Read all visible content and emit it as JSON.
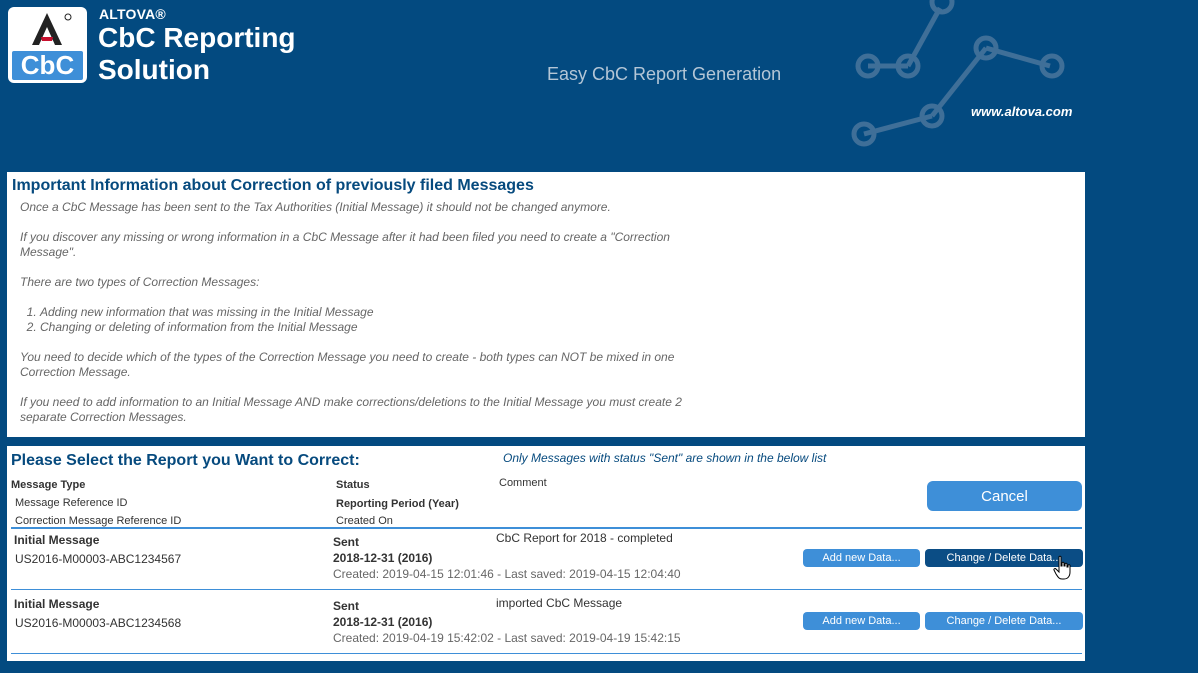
{
  "header": {
    "logo_top": "A",
    "logo_label": "CbC",
    "brand_small": "ALTOVA®",
    "brand_line1": "CbC Reporting",
    "brand_line2": "Solution",
    "tagline": "Easy CbC Report Generation",
    "website": "www.altova.com"
  },
  "info": {
    "title": "Important Information about Correction of previously filed Messages",
    "p1": "Once a CbC Message has been sent to the Tax Authorities (Initial Message) it should not be changed anymore.",
    "p2": "If you discover any missing or wrong information in a CbC Message after it had been filed you need to create a \"Correction Message\".",
    "p3": "There are two types of Correction Messages:",
    "items": [
      "Adding new information that was missing in the Initial Message",
      "Changing or deleting of information from the Initial Message"
    ],
    "p4": "You need to decide which of the types of the Correction Message you need to create - both types can NOT be mixed in one Correction Message.",
    "p5": "If you need to add information to an Initial Message AND make corrections/deletions to the Initial Message you must create 2 separate Correction Messages."
  },
  "select": {
    "title": "Please Select the Report you Want to Correct:",
    "note": "Only Messages with status \"Sent\" are shown in the below list",
    "headers": {
      "message_type": "Message Type",
      "message_ref": "Message Reference ID",
      "correction_ref": "Correction Message Reference ID",
      "status": "Status",
      "reporting_period": "Reporting Period (Year)",
      "created_on": "Created On",
      "comment": "Comment"
    },
    "cancel_label": "Cancel",
    "rows": [
      {
        "type": "Initial Message",
        "ref": "US2016-M00003-ABC1234567",
        "status": "Sent",
        "period": "2018-12-31 (2016)",
        "created": "Created: 2019-04-15 12:01:46 - Last saved: 2019-04-15 12:04:40",
        "comment": "CbC Report for 2018 - completed",
        "add_label": "Add new Data...",
        "change_label": "Change / Delete Data..."
      },
      {
        "type": "Initial Message",
        "ref": "US2016-M00003-ABC1234568",
        "status": "Sent",
        "period": "2018-12-31 (2016)",
        "created": "Created: 2019-04-19 15:42:02 - Last saved: 2019-04-19 15:42:15",
        "comment": "imported CbC Message",
        "add_label": "Add new Data...",
        "change_label": "Change / Delete Data..."
      }
    ]
  },
  "colors": {
    "background": "#034a80",
    "accent": "#3e8fd8",
    "button_hover": "#0b4d85",
    "title": "#064a7e"
  },
  "icons": [
    "altova-logo-icon",
    "network-graphic-icon",
    "hand-pointer-icon"
  ]
}
